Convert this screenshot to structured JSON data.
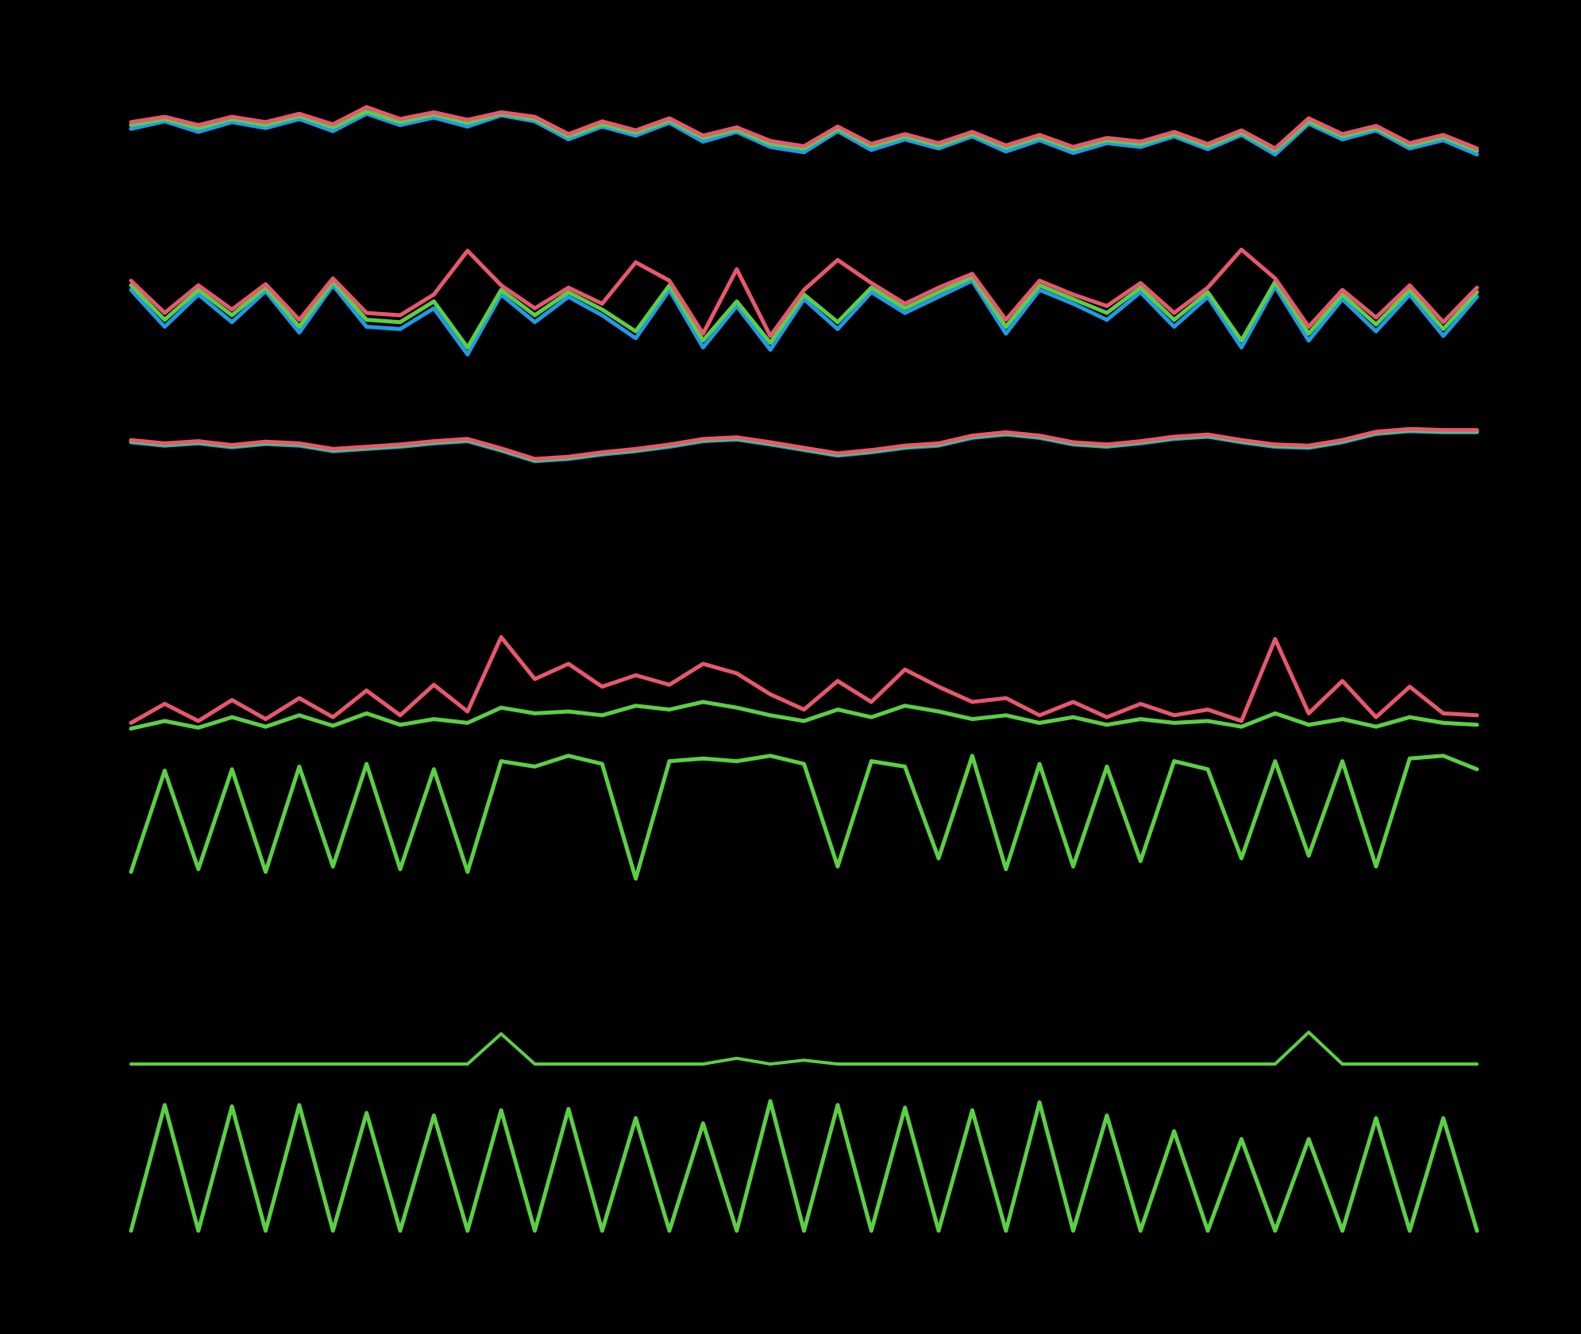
{
  "chart_data": {
    "type": "line",
    "grid": false,
    "legend": "none",
    "colors": {
      "background": "#000000",
      "red": "#e8576e",
      "green": "#5ccf45",
      "blue": "#1f9be6"
    },
    "x": [
      0,
      2.5,
      5,
      7.5,
      10,
      12.5,
      15,
      17.5,
      20,
      22.5,
      25,
      27.5,
      30,
      32.5,
      35,
      37.5,
      40,
      42.5,
      45,
      47.5,
      50,
      52.5,
      55,
      57.5,
      60,
      62.5,
      65,
      67.5,
      70,
      72.5,
      75,
      77.5,
      80,
      82.5,
      85,
      87.5,
      90,
      92.5,
      95,
      97.5,
      100
    ],
    "panels": [
      {
        "id": "panel-1",
        "ylim": [
          0,
          1
        ],
        "series": [
          {
            "color": "#1f9be6",
            "values": [
              0.66,
              0.76,
              0.62,
              0.75,
              0.67,
              0.79,
              0.63,
              0.86,
              0.71,
              0.81,
              0.69,
              0.84,
              0.76,
              0.52,
              0.69,
              0.57,
              0.74,
              0.49,
              0.62,
              0.42,
              0.35,
              0.63,
              0.38,
              0.52,
              0.4,
              0.56,
              0.36,
              0.51,
              0.34,
              0.47,
              0.42,
              0.56,
              0.39,
              0.58,
              0.32,
              0.73,
              0.52,
              0.64,
              0.4,
              0.51,
              0.32
            ]
          },
          {
            "color": "#5ccf45",
            "values": [
              0.71,
              0.79,
              0.67,
              0.79,
              0.71,
              0.83,
              0.68,
              0.89,
              0.75,
              0.85,
              0.74,
              0.86,
              0.79,
              0.56,
              0.72,
              0.61,
              0.77,
              0.54,
              0.65,
              0.46,
              0.4,
              0.66,
              0.43,
              0.56,
              0.44,
              0.59,
              0.41,
              0.55,
              0.39,
              0.51,
              0.46,
              0.59,
              0.43,
              0.61,
              0.37,
              0.76,
              0.56,
              0.67,
              0.44,
              0.55,
              0.37
            ]
          },
          {
            "color": "#e8576e",
            "values": [
              0.75,
              0.82,
              0.71,
              0.82,
              0.75,
              0.86,
              0.72,
              0.95,
              0.79,
              0.88,
              0.78,
              0.88,
              0.82,
              0.59,
              0.76,
              0.64,
              0.8,
              0.57,
              0.68,
              0.5,
              0.43,
              0.69,
              0.46,
              0.59,
              0.47,
              0.62,
              0.44,
              0.58,
              0.42,
              0.54,
              0.49,
              0.62,
              0.46,
              0.64,
              0.4,
              0.8,
              0.59,
              0.7,
              0.47,
              0.58,
              0.4
            ]
          }
        ]
      },
      {
        "id": "panel-2",
        "ylim": [
          0,
          1
        ],
        "series": [
          {
            "color": "#1f9be6",
            "values": [
              0.62,
              0.3,
              0.58,
              0.34,
              0.61,
              0.25,
              0.66,
              0.3,
              0.28,
              0.46,
              0.06,
              0.58,
              0.34,
              0.56,
              0.4,
              0.2,
              0.62,
              0.12,
              0.48,
              0.1,
              0.54,
              0.28,
              0.6,
              0.42,
              0.56,
              0.7,
              0.24,
              0.62,
              0.5,
              0.36,
              0.6,
              0.3,
              0.56,
              0.12,
              0.65,
              0.18,
              0.54,
              0.26,
              0.58,
              0.22,
              0.56
            ]
          },
          {
            "color": "#5ccf45",
            "values": [
              0.66,
              0.36,
              0.62,
              0.4,
              0.64,
              0.3,
              0.69,
              0.36,
              0.34,
              0.52,
              0.12,
              0.62,
              0.4,
              0.6,
              0.45,
              0.26,
              0.66,
              0.18,
              0.52,
              0.16,
              0.58,
              0.34,
              0.64,
              0.46,
              0.6,
              0.73,
              0.3,
              0.66,
              0.54,
              0.42,
              0.64,
              0.36,
              0.6,
              0.18,
              0.69,
              0.24,
              0.58,
              0.32,
              0.62,
              0.28,
              0.6
            ]
          },
          {
            "color": "#e8576e",
            "values": [
              0.7,
              0.42,
              0.66,
              0.45,
              0.67,
              0.36,
              0.72,
              0.42,
              0.4,
              0.58,
              0.96,
              0.66,
              0.46,
              0.64,
              0.5,
              0.86,
              0.7,
              0.24,
              0.8,
              0.22,
              0.62,
              0.88,
              0.68,
              0.5,
              0.64,
              0.76,
              0.36,
              0.7,
              0.58,
              0.48,
              0.68,
              0.42,
              0.64,
              0.97,
              0.72,
              0.3,
              0.62,
              0.38,
              0.66,
              0.34,
              0.64
            ]
          }
        ]
      },
      {
        "id": "panel-3",
        "ylim": [
          0,
          1
        ],
        "series": [
          {
            "color": "#1f9be6",
            "values": [
              0.4,
              0.34,
              0.38,
              0.31,
              0.37,
              0.34,
              0.24,
              0.28,
              0.32,
              0.38,
              0.42,
              0.25,
              0.06,
              0.1,
              0.18,
              0.24,
              0.32,
              0.42,
              0.45,
              0.36,
              0.26,
              0.16,
              0.22,
              0.3,
              0.34,
              0.48,
              0.54,
              0.48,
              0.36,
              0.32,
              0.38,
              0.46,
              0.5,
              0.4,
              0.32,
              0.3,
              0.4,
              0.55,
              0.6,
              0.58,
              0.58
            ]
          },
          {
            "color": "#5ccf45",
            "values": [
              0.42,
              0.36,
              0.4,
              0.33,
              0.39,
              0.36,
              0.26,
              0.3,
              0.34,
              0.4,
              0.44,
              0.27,
              0.08,
              0.12,
              0.2,
              0.26,
              0.34,
              0.44,
              0.47,
              0.38,
              0.28,
              0.18,
              0.24,
              0.32,
              0.36,
              0.5,
              0.56,
              0.5,
              0.38,
              0.34,
              0.4,
              0.48,
              0.52,
              0.42,
              0.34,
              0.32,
              0.42,
              0.57,
              0.62,
              0.6,
              0.6
            ]
          },
          {
            "color": "#e8576e",
            "values": [
              0.44,
              0.38,
              0.42,
              0.35,
              0.41,
              0.38,
              0.28,
              0.32,
              0.36,
              0.42,
              0.46,
              0.29,
              0.1,
              0.14,
              0.22,
              0.28,
              0.36,
              0.46,
              0.49,
              0.4,
              0.3,
              0.2,
              0.26,
              0.34,
              0.38,
              0.52,
              0.58,
              0.52,
              0.4,
              0.36,
              0.42,
              0.5,
              0.54,
              0.44,
              0.36,
              0.34,
              0.44,
              0.59,
              0.64,
              0.62,
              0.62
            ]
          }
        ]
      },
      {
        "id": "panel-4",
        "ylim": [
          0,
          1
        ],
        "series": [
          {
            "color": "#5ccf45",
            "values": [
              0.02,
              0.1,
              0.03,
              0.14,
              0.04,
              0.16,
              0.05,
              0.18,
              0.06,
              0.12,
              0.08,
              0.24,
              0.18,
              0.2,
              0.16,
              0.26,
              0.22,
              0.3,
              0.24,
              0.16,
              0.1,
              0.22,
              0.14,
              0.26,
              0.2,
              0.12,
              0.16,
              0.08,
              0.14,
              0.06,
              0.12,
              0.08,
              0.1,
              0.04,
              0.18,
              0.06,
              0.12,
              0.04,
              0.14,
              0.08,
              0.06
            ]
          },
          {
            "color": "#e8576e",
            "values": [
              0.08,
              0.28,
              0.1,
              0.32,
              0.12,
              0.34,
              0.14,
              0.42,
              0.16,
              0.48,
              0.2,
              0.98,
              0.54,
              0.7,
              0.46,
              0.58,
              0.48,
              0.7,
              0.6,
              0.38,
              0.22,
              0.52,
              0.3,
              0.64,
              0.46,
              0.3,
              0.34,
              0.16,
              0.3,
              0.14,
              0.28,
              0.16,
              0.22,
              0.1,
              0.96,
              0.18,
              0.52,
              0.14,
              0.46,
              0.18,
              0.16
            ]
          }
        ]
      },
      {
        "id": "panel-5",
        "ylim": [
          0,
          1
        ],
        "series": [
          {
            "color": "#5ccf45",
            "values": [
              0.1,
              0.85,
              0.12,
              0.86,
              0.1,
              0.88,
              0.14,
              0.9,
              0.12,
              0.86,
              0.1,
              0.92,
              0.88,
              0.96,
              0.9,
              0.05,
              0.92,
              0.94,
              0.92,
              0.96,
              0.9,
              0.14,
              0.92,
              0.88,
              0.2,
              0.96,
              0.12,
              0.9,
              0.14,
              0.88,
              0.18,
              0.92,
              0.86,
              0.2,
              0.92,
              0.22,
              0.92,
              0.14,
              0.94,
              0.96,
              0.86
            ]
          }
        ]
      },
      {
        "id": "panel-6",
        "ylim": [
          0,
          1
        ],
        "series": [
          {
            "color": "#5ccf45",
            "values": [
              0.0,
              0.0,
              0.0,
              0.0,
              0.0,
              0.0,
              0.0,
              0.0,
              0.0,
              0.0,
              0.0,
              0.95,
              0.0,
              0.0,
              0.0,
              0.0,
              0.0,
              0.0,
              0.18,
              0.0,
              0.12,
              0.0,
              0.0,
              0.0,
              0.0,
              0.0,
              0.0,
              0.0,
              0.0,
              0.0,
              0.0,
              0.0,
              0.0,
              0.0,
              0.0,
              1.0,
              0.0,
              0.0,
              0.0,
              0.0,
              0.0
            ]
          }
        ]
      },
      {
        "id": "panel-7",
        "ylim": [
          0,
          1
        ],
        "series": [
          {
            "color": "#5ccf45",
            "values": [
              0.0,
              0.96,
              0.0,
              0.95,
              0.0,
              0.96,
              0.0,
              0.9,
              0.0,
              0.88,
              0.0,
              0.92,
              0.0,
              0.93,
              0.0,
              0.86,
              0.0,
              0.82,
              0.0,
              0.99,
              0.0,
              0.96,
              0.0,
              0.94,
              0.0,
              0.92,
              0.0,
              0.98,
              0.0,
              0.88,
              0.0,
              0.76,
              0.0,
              0.7,
              0.0,
              0.7,
              0.0,
              0.86,
              0.0,
              0.86,
              0.0
            ]
          }
        ]
      }
    ]
  }
}
